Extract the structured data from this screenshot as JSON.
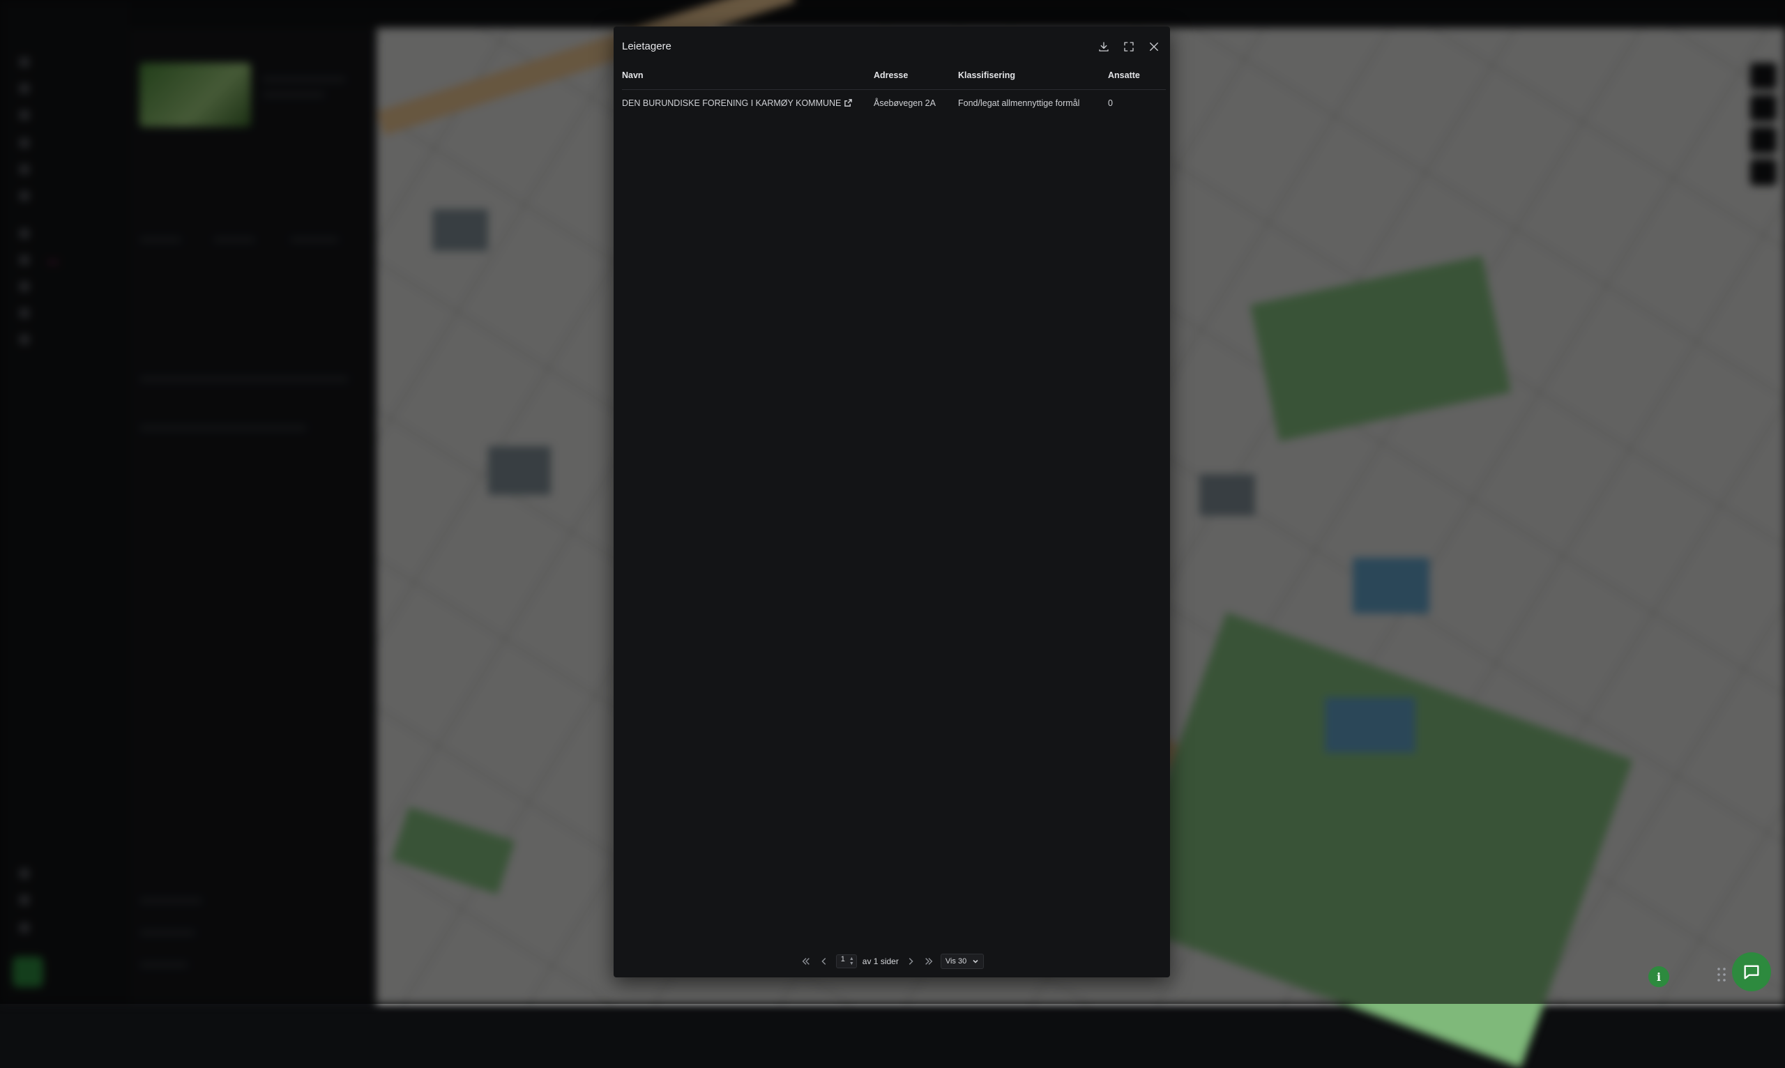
{
  "modal": {
    "title": "Leietagere",
    "columns": [
      "Navn",
      "Adresse",
      "Klassifisering",
      "Ansatte"
    ],
    "rows": [
      {
        "navn": "DEN BURUNDISKE FORENING I KARMØY KOMMUNE",
        "adresse": "Åsebøvegen 2A",
        "klassifisering": "Fond/legat allmennyttige formål",
        "ansatte": "0"
      }
    ]
  },
  "pagination": {
    "current_page": "1",
    "of_pages_label": "av 1 sider",
    "page_size_label": "Vis 30"
  },
  "icons": {
    "download": "download-icon",
    "fullscreen": "fullscreen-icon",
    "close": "close-icon",
    "external_link": "external-link-icon",
    "info": "info-icon",
    "chat": "chat-icon"
  },
  "colors": {
    "accent_green": "#2d8a3e",
    "modal_bg": "#131416",
    "badge_pink": "#c5307f"
  }
}
